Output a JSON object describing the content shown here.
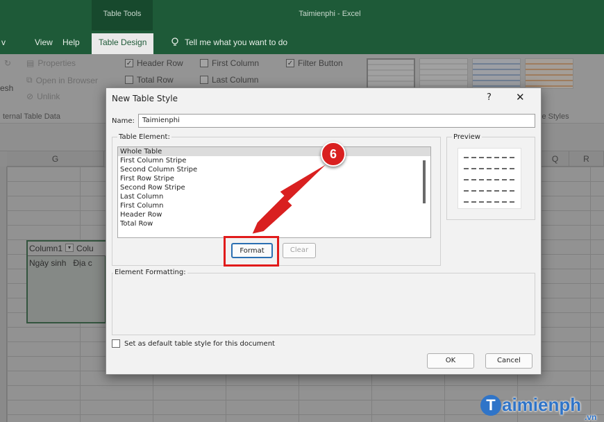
{
  "titlebar": {
    "table_tools": "Table Tools",
    "app_title": "Taimienphi  -  Excel"
  },
  "menu": {
    "items": [
      "View",
      "Help"
    ],
    "active": "Table Design",
    "tell_me": "Tell me what you want to do"
  },
  "ribbon": {
    "properties": "Properties",
    "open_in_browser": "Open in Browser",
    "unlink": "Unlink",
    "refresh_fragment": "esh",
    "external_group": "ternal Table Data",
    "header_row": "Header Row",
    "total_row": "Total Row",
    "first_column": "First Column",
    "last_column": "Last Column",
    "filter_button": "Filter Button",
    "styles_group": "le Styles"
  },
  "sheet": {
    "col_g": "G",
    "col_q": "Q",
    "col_r": "R",
    "table_header_1": "Column1",
    "table_header_2": "Colu",
    "table_cell_1": "Ngày sinh",
    "table_cell_2": "Địa c"
  },
  "dialog": {
    "title": "New Table Style",
    "help": "?",
    "close": "✕",
    "name_label": "Name:",
    "name_value": "Taimienphi",
    "table_element_label": "Table Element:",
    "elements": [
      "Whole Table",
      "First Column Stripe",
      "Second Column Stripe",
      "First Row Stripe",
      "Second Row Stripe",
      "Last Column",
      "First Column",
      "Header Row",
      "Total Row"
    ],
    "format_button": "Format",
    "clear_button": "Clear",
    "preview_label": "Preview",
    "element_formatting_label": "Element Formatting:",
    "default_checkbox": "Set as default table style for this document",
    "ok": "OK",
    "cancel": "Cancel"
  },
  "annotation": {
    "step": "6",
    "color": "#e11b1b"
  },
  "watermark": {
    "initial": "T",
    "text": "aimienph",
    "tld": ".vn"
  },
  "colors": {
    "excel_green": "#1e5a38",
    "accent_blue": "#2b6fb2"
  }
}
